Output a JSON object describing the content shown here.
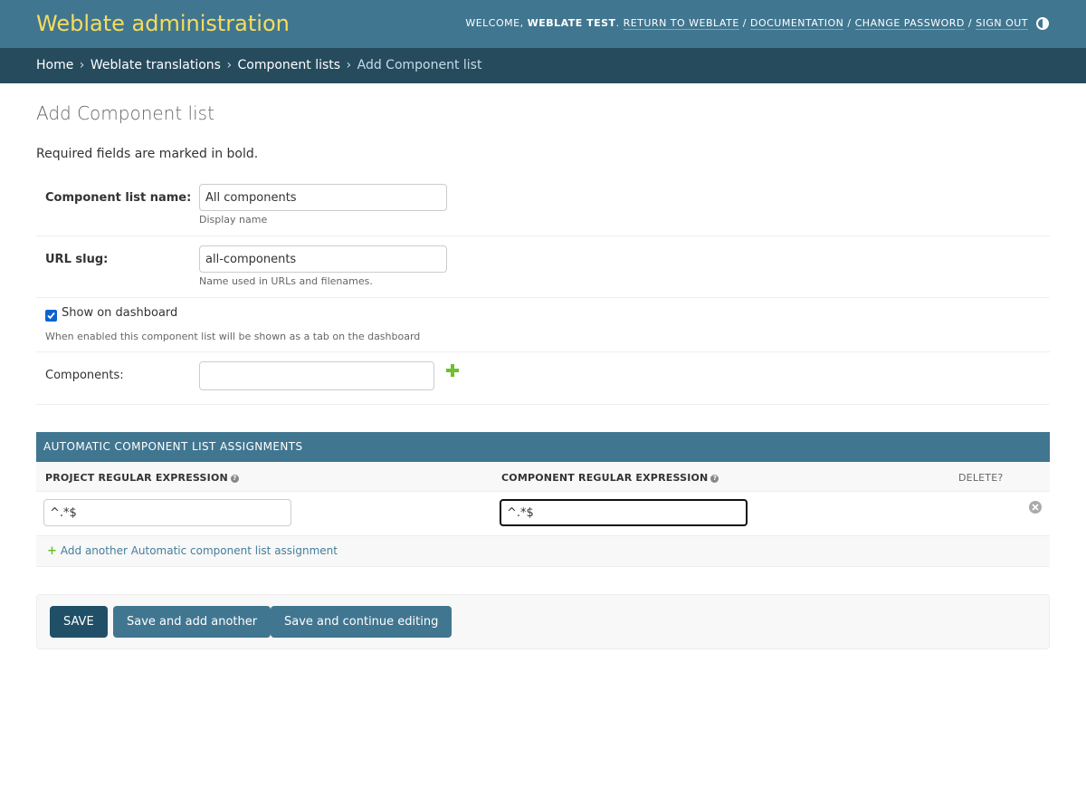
{
  "header": {
    "site_name": "Weblate administration",
    "welcome": "Welcome,",
    "username": "Weblate test",
    "links": {
      "return": "Return to Weblate",
      "documentation": "Documentation",
      "change_password": "Change password",
      "sign_out": "Sign out"
    },
    "separator": "/"
  },
  "breadcrumbs": {
    "home": "Home",
    "app": "Weblate translations",
    "model": "Component lists",
    "current": "Add Component list",
    "separator": "›"
  },
  "page": {
    "title": "Add Component list",
    "required_note": "Required fields are marked in bold."
  },
  "form": {
    "name": {
      "label": "Component list name:",
      "value": "All components",
      "help": "Display name"
    },
    "slug": {
      "label": "URL slug:",
      "value": "all-components",
      "help": "Name used in URLs and filenames."
    },
    "show_dashboard": {
      "label": "Show on dashboard",
      "checked": true,
      "help": "When enabled this component list will be shown as a tab on the dashboard"
    },
    "components": {
      "label": "Components:",
      "value": "",
      "add_icon": "plus-icon"
    }
  },
  "inline": {
    "caption": "Automatic component list assignments",
    "columns": {
      "project": "Project regular expression",
      "component": "Component regular expression",
      "delete": "Delete?"
    },
    "rows": [
      {
        "project_regex": "^.*$",
        "component_regex": "^.*$"
      }
    ],
    "add_another": "Add another Automatic component list assignment"
  },
  "submit": {
    "save": "Save",
    "save_add_another": "Save and add another",
    "save_continue": "Save and continue editing"
  },
  "colors": {
    "header_bg": "#417690",
    "site_name": "#f5dd5d",
    "breadcrumbs_bg": "#264b5d",
    "save_button": "#205067",
    "secondary_button": "#417690",
    "add_green": "#70bf2b"
  }
}
